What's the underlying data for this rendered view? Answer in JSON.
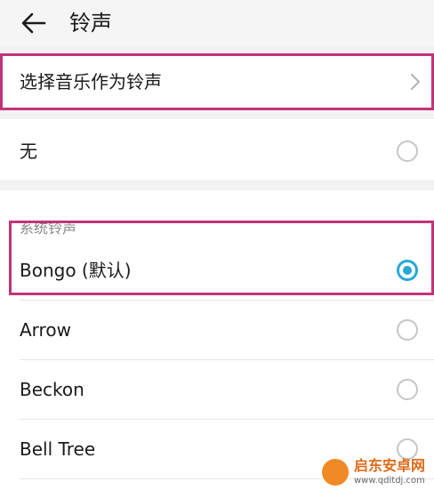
{
  "header": {
    "title": "铃声",
    "back_icon": "arrow-left-icon"
  },
  "music_row": {
    "label": "选择音乐作为铃声",
    "icon": "chevron-right-icon"
  },
  "none_row": {
    "label": "无",
    "selected": false
  },
  "system_section": {
    "label": "系统铃声",
    "items": [
      {
        "label": "Bongo (默认)",
        "selected": true
      },
      {
        "label": "Arrow",
        "selected": false
      },
      {
        "label": "Beckon",
        "selected": false
      },
      {
        "label": "Bell Tree",
        "selected": false
      }
    ]
  },
  "colors": {
    "accent": "#26a8d8",
    "highlight": "#c2347a"
  },
  "watermark": {
    "title": "启东安卓网",
    "url": "www.qdltdj.com"
  }
}
